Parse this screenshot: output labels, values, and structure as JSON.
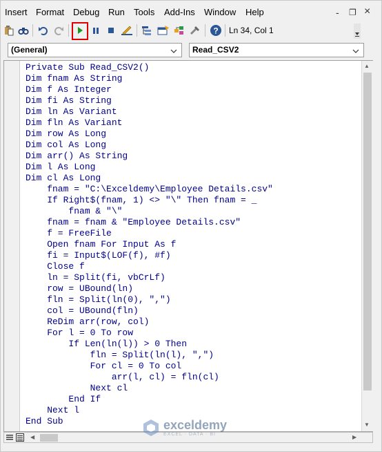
{
  "menu": {
    "items": [
      "Insert",
      "Format",
      "Debug",
      "Run",
      "Tools",
      "Add-Ins",
      "Window",
      "Help"
    ]
  },
  "window_controls": {
    "close": "×",
    "restore": "❐",
    "minimize": "‐"
  },
  "status": {
    "position": "Ln 34, Col 1"
  },
  "combo": {
    "object": "(General)",
    "procedure": "Read_CSV2"
  },
  "watermark": {
    "name": "exceldemy",
    "tagline": "EXCEL · DATA · BI"
  },
  "code_lines": [
    "Private Sub Read_CSV2()",
    "Dim fnam As String",
    "Dim f As Integer",
    "Dim fi As String",
    "Dim ln As Variant",
    "Dim fln As Variant",
    "Dim row As Long",
    "Dim col As Long",
    "Dim arr() As String",
    "Dim l As Long",
    "Dim cl As Long",
    "    fnam = \"C:\\Exceldemy\\Employee Details.csv\"",
    "    If Right$(fnam, 1) <> \"\\\" Then fnam = _",
    "        fnam & \"\\\"",
    "    fnam = fnam & \"Employee Details.csv\"",
    "    f = FreeFile",
    "    Open fnam For Input As f",
    "    fi = Input$(LOF(f), #f)",
    "    Close f",
    "    ln = Split(fi, vbCrLf)",
    "    row = UBound(ln)",
    "    fln = Split(ln(0), \",\")",
    "    col = UBound(fln)",
    "    ReDim arr(row, col)",
    "    For l = 0 To row",
    "        If Len(ln(l)) > 0 Then",
    "            fln = Split(ln(l), \",\")",
    "            For cl = 0 To col",
    "                arr(l, cl) = fln(cl)",
    "            Next cl",
    "        End If",
    "    Next l",
    "End Sub"
  ],
  "colors": {
    "code": "#00008b",
    "run_highlight": "#e00000",
    "run_icon": "#1a9a1a"
  }
}
